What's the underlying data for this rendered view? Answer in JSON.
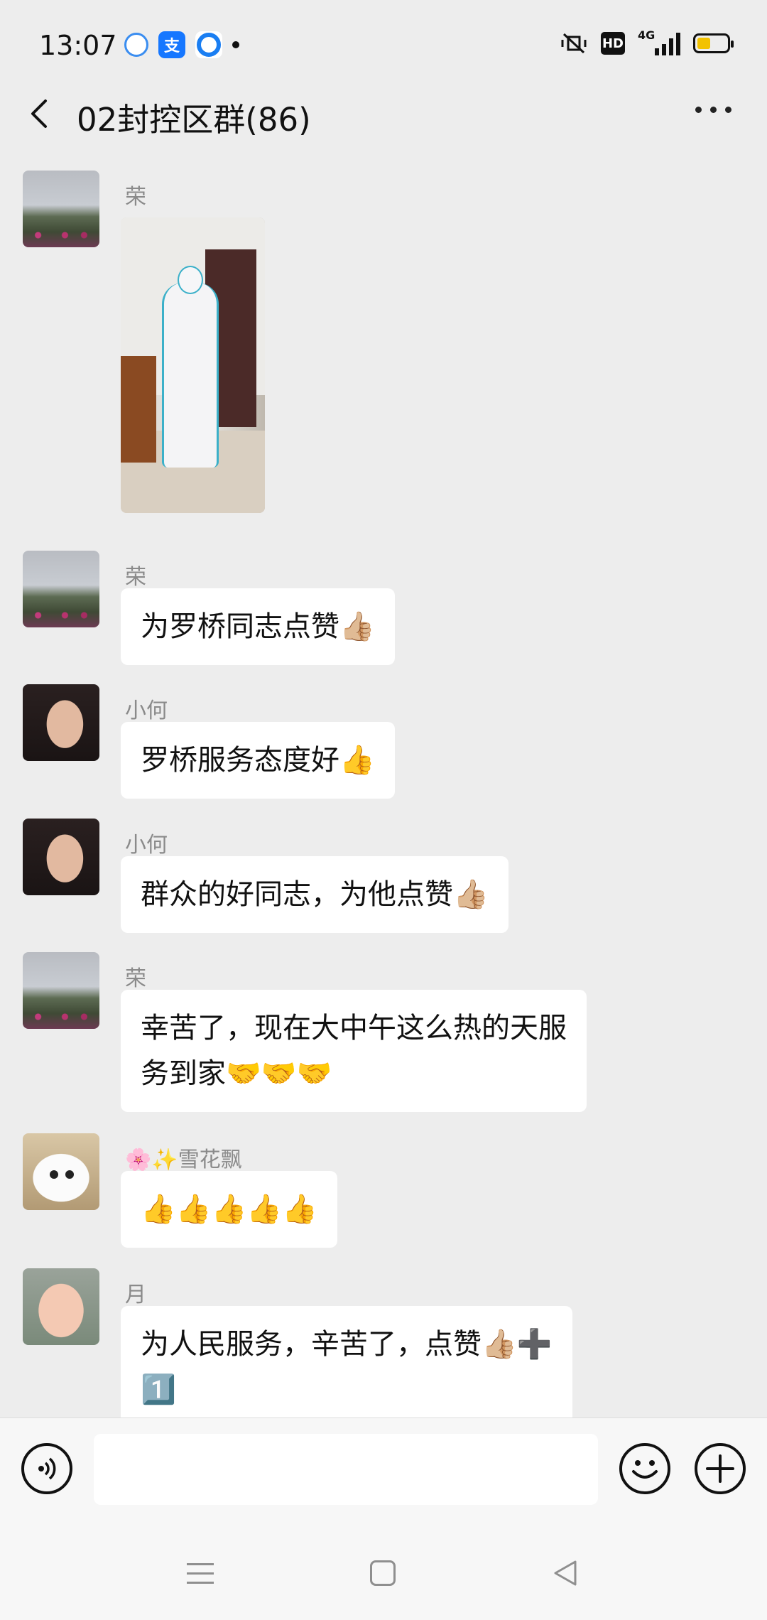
{
  "status_bar": {
    "time": "13:07",
    "network": "4G",
    "alipay_glyph": "支",
    "hd": "HD"
  },
  "header": {
    "title": "02封控区群(86)"
  },
  "messages": [
    {
      "sender": "荣",
      "type": "image",
      "avatar": "landscape-avatar"
    },
    {
      "sender": "荣",
      "text": "为罗桥同志点赞👍🏼",
      "avatar": "landscape-avatar"
    },
    {
      "sender": "小何",
      "text": "罗桥服务态度好👍",
      "avatar": "woman-avatar"
    },
    {
      "sender": "小何",
      "text": "群众的好同志，为他点赞👍🏼",
      "avatar": "woman-avatar"
    },
    {
      "sender": "荣",
      "text_line1": "幸苦了，现在大中午这么热的天服",
      "text_line2": "务到家🤝🤝🤝",
      "avatar": "landscape-avatar"
    },
    {
      "sender": "🌸✨雪花飘",
      "text": "👍👍👍👍👍",
      "avatar": "cat-avatar"
    },
    {
      "sender": "月",
      "text_line1": "为人民服务，辛苦了，点赞👍🏼➕",
      "text_line2": "1️⃣",
      "avatar": "baby-avatar"
    }
  ],
  "input_bar": {
    "placeholder": ""
  },
  "colors": {
    "background": "#ededed",
    "bubble": "#ffffff",
    "sender": "#8a8a8a",
    "battery": "#f2c200"
  }
}
